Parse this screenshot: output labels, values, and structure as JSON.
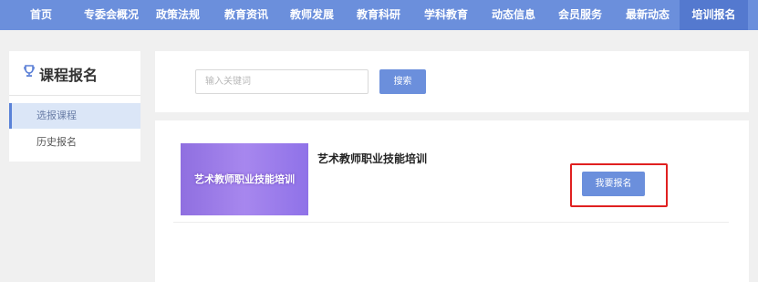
{
  "nav": {
    "items": [
      {
        "label": "首页",
        "active": false
      },
      {
        "label": "专委会概况",
        "active": false
      },
      {
        "label": "政策法规",
        "active": false
      },
      {
        "label": "教育资讯",
        "active": false
      },
      {
        "label": "教师发展",
        "active": false
      },
      {
        "label": "教育科研",
        "active": false
      },
      {
        "label": "学科教育",
        "active": false
      },
      {
        "label": "动态信息",
        "active": false
      },
      {
        "label": "会员服务",
        "active": false
      },
      {
        "label": "最新动态",
        "active": false
      },
      {
        "label": "培训报名",
        "active": true
      }
    ]
  },
  "sidebar": {
    "title": "课程报名",
    "icon": "trophy-icon",
    "items": [
      {
        "label": "选报课程",
        "active": true
      },
      {
        "label": "历史报名",
        "active": false
      }
    ]
  },
  "search": {
    "placeholder": "输入关键词",
    "value": "",
    "button_label": "搜索"
  },
  "courses": [
    {
      "thumbnail_text": "艺术教师职业技能培训",
      "title": "艺术教师职业技能培训",
      "enroll_label": "我要报名"
    }
  ],
  "colors": {
    "accent": "#6b8fdc",
    "highlight": "#e02020",
    "background": "#f0f0f0"
  }
}
